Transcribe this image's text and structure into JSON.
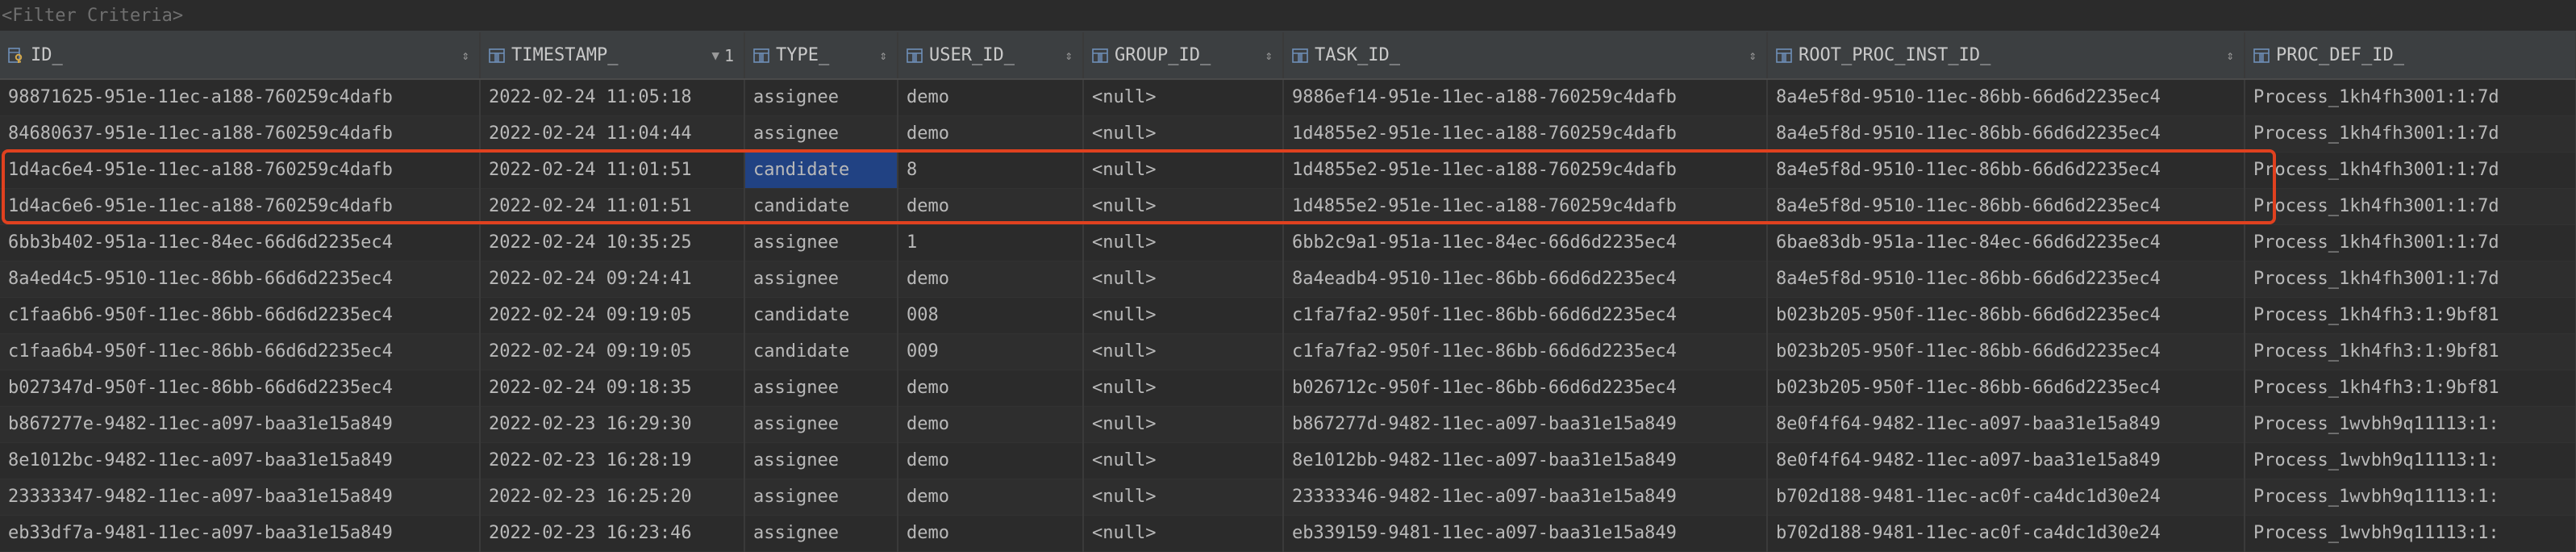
{
  "filter": {
    "placeholder": "<Filter Criteria>"
  },
  "columns": [
    {
      "key": "id",
      "label": "ID_",
      "icon": "key-column-icon",
      "sort_indicator": "⇕",
      "sort_order": ""
    },
    {
      "key": "timestamp",
      "label": "TIMESTAMP_",
      "icon": "table-column-icon",
      "sort_indicator": "▼",
      "sort_order": "1"
    },
    {
      "key": "type",
      "label": "TYPE_",
      "icon": "table-column-icon",
      "sort_indicator": "⇕",
      "sort_order": ""
    },
    {
      "key": "user_id",
      "label": "USER_ID_",
      "icon": "table-column-icon",
      "sort_indicator": "⇕",
      "sort_order": ""
    },
    {
      "key": "group_id",
      "label": "GROUP_ID_",
      "icon": "table-column-icon",
      "sort_indicator": "⇕",
      "sort_order": ""
    },
    {
      "key": "task_id",
      "label": "TASK_ID_",
      "icon": "table-column-icon",
      "sort_indicator": "⇕",
      "sort_order": ""
    },
    {
      "key": "root_proc_inst_id",
      "label": "ROOT_PROC_INST_ID_",
      "icon": "table-column-icon",
      "sort_indicator": "⇕",
      "sort_order": ""
    },
    {
      "key": "proc_def_id",
      "label": "PROC_DEF_ID_",
      "icon": "table-column-icon",
      "sort_indicator": "",
      "sort_order": ""
    }
  ],
  "rows": [
    [
      "98871625-951e-11ec-a188-760259c4dafb",
      "2022-02-24 11:05:18",
      "assignee",
      "demo",
      "<null>",
      "9886ef14-951e-11ec-a188-760259c4dafb",
      "8a4e5f8d-9510-11ec-86bb-66d6d2235ec4",
      "Process_1kh4fh3001:1:7d"
    ],
    [
      "84680637-951e-11ec-a188-760259c4dafb",
      "2022-02-24 11:04:44",
      "assignee",
      "demo",
      "<null>",
      "1d4855e2-951e-11ec-a188-760259c4dafb",
      "8a4e5f8d-9510-11ec-86bb-66d6d2235ec4",
      "Process_1kh4fh3001:1:7d"
    ],
    [
      "1d4ac6e4-951e-11ec-a188-760259c4dafb",
      "2022-02-24 11:01:51",
      "candidate",
      "8",
      "<null>",
      "1d4855e2-951e-11ec-a188-760259c4dafb",
      "8a4e5f8d-9510-11ec-86bb-66d6d2235ec4",
      "Process_1kh4fh3001:1:7d"
    ],
    [
      "1d4ac6e6-951e-11ec-a188-760259c4dafb",
      "2022-02-24 11:01:51",
      "candidate",
      "demo",
      "<null>",
      "1d4855e2-951e-11ec-a188-760259c4dafb",
      "8a4e5f8d-9510-11ec-86bb-66d6d2235ec4",
      "Process_1kh4fh3001:1:7d"
    ],
    [
      "6bb3b402-951a-11ec-84ec-66d6d2235ec4",
      "2022-02-24 10:35:25",
      "assignee",
      "1",
      "<null>",
      "6bb2c9a1-951a-11ec-84ec-66d6d2235ec4",
      "6bae83db-951a-11ec-84ec-66d6d2235ec4",
      "Process_1kh4fh3001:1:7d"
    ],
    [
      "8a4ed4c5-9510-11ec-86bb-66d6d2235ec4",
      "2022-02-24 09:24:41",
      "assignee",
      "demo",
      "<null>",
      "8a4eadb4-9510-11ec-86bb-66d6d2235ec4",
      "8a4e5f8d-9510-11ec-86bb-66d6d2235ec4",
      "Process_1kh4fh3001:1:7d"
    ],
    [
      "c1faa6b6-950f-11ec-86bb-66d6d2235ec4",
      "2022-02-24 09:19:05",
      "candidate",
      "008",
      "<null>",
      "c1fa7fa2-950f-11ec-86bb-66d6d2235ec4",
      "b023b205-950f-11ec-86bb-66d6d2235ec4",
      "Process_1kh4fh3:1:9bf81"
    ],
    [
      "c1faa6b4-950f-11ec-86bb-66d6d2235ec4",
      "2022-02-24 09:19:05",
      "candidate",
      "009",
      "<null>",
      "c1fa7fa2-950f-11ec-86bb-66d6d2235ec4",
      "b023b205-950f-11ec-86bb-66d6d2235ec4",
      "Process_1kh4fh3:1:9bf81"
    ],
    [
      "b027347d-950f-11ec-86bb-66d6d2235ec4",
      "2022-02-24 09:18:35",
      "assignee",
      "demo",
      "<null>",
      "b026712c-950f-11ec-86bb-66d6d2235ec4",
      "b023b205-950f-11ec-86bb-66d6d2235ec4",
      "Process_1kh4fh3:1:9bf81"
    ],
    [
      "b867277e-9482-11ec-a097-baa31e15a849",
      "2022-02-23 16:29:30",
      "assignee",
      "demo",
      "<null>",
      "b867277d-9482-11ec-a097-baa31e15a849",
      "8e0f4f64-9482-11ec-a097-baa31e15a849",
      "Process_1wvbh9q11113:1:"
    ],
    [
      "8e1012bc-9482-11ec-a097-baa31e15a849",
      "2022-02-23 16:28:19",
      "assignee",
      "demo",
      "<null>",
      "8e1012bb-9482-11ec-a097-baa31e15a849",
      "8e0f4f64-9482-11ec-a097-baa31e15a849",
      "Process_1wvbh9q11113:1:"
    ],
    [
      "23333347-9482-11ec-a097-baa31e15a849",
      "2022-02-23 16:25:20",
      "assignee",
      "demo",
      "<null>",
      "23333346-9482-11ec-a097-baa31e15a849",
      "b702d188-9481-11ec-ac0f-ca4dc1d30e24",
      "Process_1wvbh9q11113:1:"
    ],
    [
      "eb33df7a-9481-11ec-a097-baa31e15a849",
      "2022-02-23 16:23:46",
      "assignee",
      "demo",
      "<null>",
      "eb339159-9481-11ec-a097-baa31e15a849",
      "b702d188-9481-11ec-ac0f-ca4dc1d30e24",
      "Process_1wvbh9q11113:1:"
    ]
  ],
  "selection": {
    "row": 2,
    "col": 2
  },
  "null_text": "<null>",
  "colors": {
    "background": "#2b2b2b",
    "header_bg": "#3c3f41",
    "selection_bg": "#214283",
    "highlight_border": "#e0411f",
    "key_icon": "#d4a84b",
    "column_icon": "#6e8fb8"
  }
}
